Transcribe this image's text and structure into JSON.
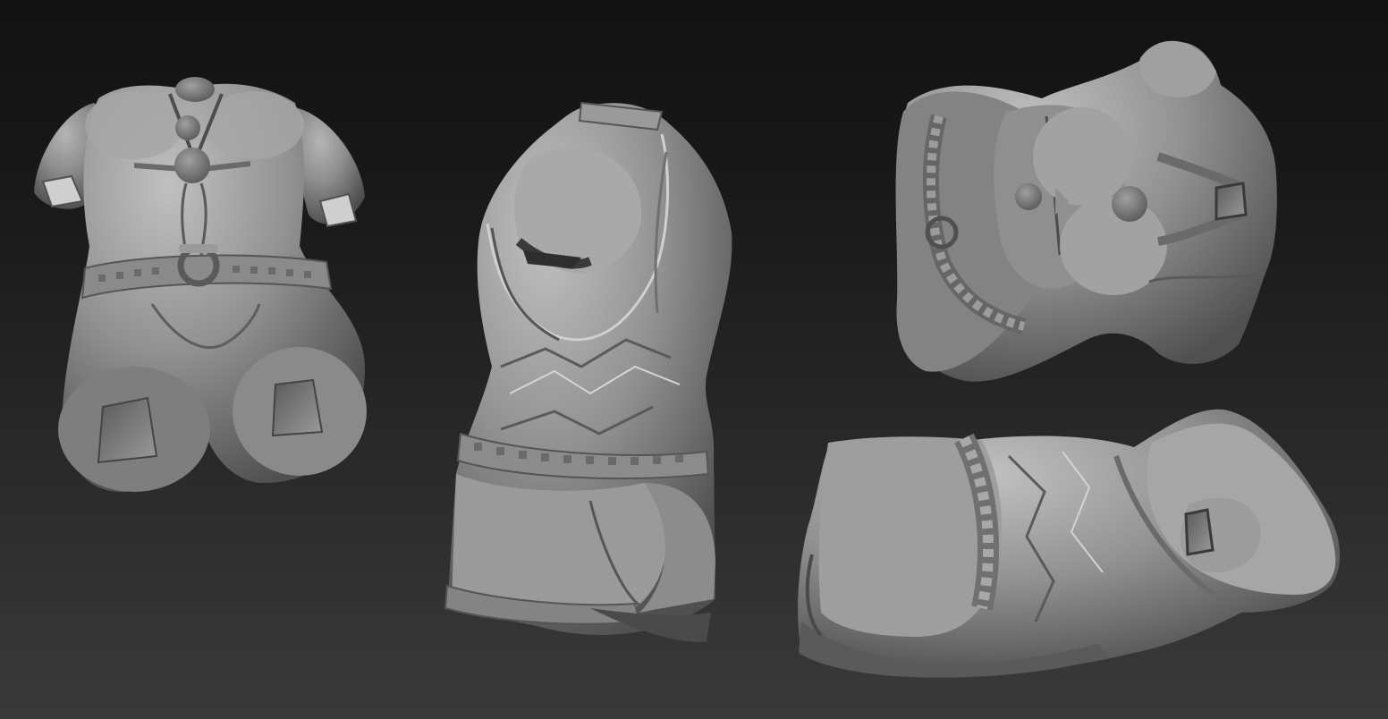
{
  "scene": {
    "background_top": "#121212",
    "background_bottom": "#3a3a3a",
    "material_light": "#a8a8a8",
    "material_mid": "#7c7c7c",
    "material_dark": "#3e3e3e",
    "views": [
      {
        "name": "front-view"
      },
      {
        "name": "back-three-quarter-view"
      },
      {
        "name": "top-down-view"
      },
      {
        "name": "side-lying-view"
      }
    ]
  }
}
